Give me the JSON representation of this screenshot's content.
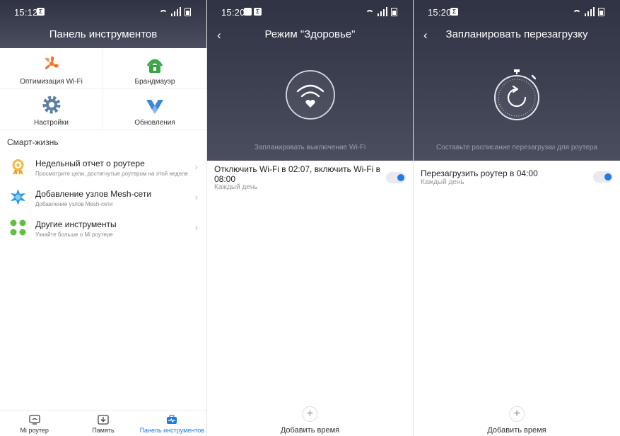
{
  "screen1": {
    "time": "15:12",
    "status_badge": "Σ",
    "title": "Панель инструментов",
    "tools": [
      {
        "label": "Оптимизация Wi-Fi",
        "icon": "fan-icon"
      },
      {
        "label": "Брандмауэр",
        "icon": "firewall-icon"
      },
      {
        "label": "Настройки",
        "icon": "gear-icon"
      },
      {
        "label": "Обновления",
        "icon": "update-icon"
      }
    ],
    "section_title": "Смарт-жизнь",
    "items": [
      {
        "title": "Недельный отчет о роутере",
        "subtitle": "Просмотрите цели, достигнутые роутером на этой неделе",
        "icon": "medal-icon"
      },
      {
        "title": "Добавление узлов Mesh-сети",
        "subtitle": "Добавление узлов Mesh-сети",
        "icon": "mesh-icon"
      },
      {
        "title": "Другие инструменты",
        "subtitle": "Узнайте больше о Mi роутере",
        "icon": "dots-icon"
      }
    ],
    "tabs": [
      {
        "label": "Mi роутер",
        "icon": "router-icon"
      },
      {
        "label": "Память",
        "icon": "storage-icon"
      },
      {
        "label": "Панель инструментов",
        "icon": "toolbox-icon",
        "active": true
      }
    ]
  },
  "screen2": {
    "time": "15:20",
    "title": "Режим \"Здоровье\"",
    "subtitle": "Запланировать выключение Wi-Fi",
    "schedule": {
      "title": "Отключить Wi-Fi в 02:07, включить Wi-Fi в 08:00",
      "repeat": "Каждый день",
      "enabled": true
    },
    "add_label": "Добавить время"
  },
  "screen3": {
    "time": "15:20",
    "title": "Запланировать перезагрузку",
    "subtitle": "Составьте расписание перезагрузки для роутера",
    "schedule": {
      "title": "Перезагрузить роутер в 04:00",
      "repeat": "Каждый день",
      "enabled": true
    },
    "add_label": "Добавить время"
  },
  "colors": {
    "accent": "#1e7ce6",
    "header": "#3d4151",
    "fan": "#f0772a",
    "firewall": "#3aa547",
    "gear": "#5c7fa3",
    "mesh": "#2b94e0",
    "dots": "#5fbf43"
  },
  "glyphs": {
    "back": "‹",
    "chevron": "›",
    "plus": "+"
  }
}
